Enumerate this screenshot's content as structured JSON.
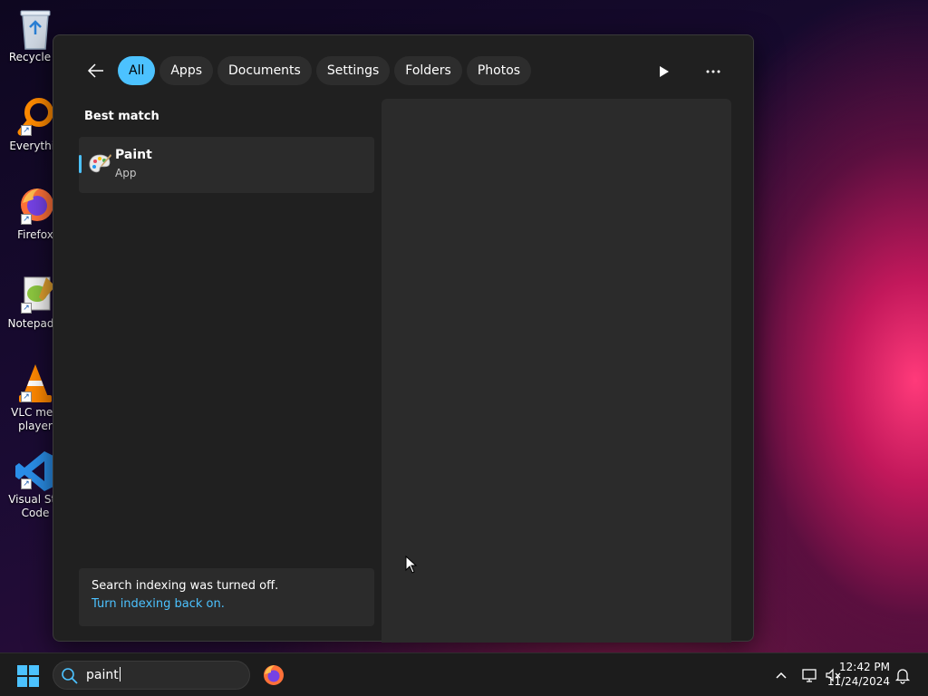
{
  "desktop": {
    "icons": [
      {
        "label": "Recycle B"
      },
      {
        "label": "Everythin"
      },
      {
        "label": "Firefox"
      },
      {
        "label": "Notepad+"
      },
      {
        "label": "VLC med player"
      },
      {
        "label": "Visual Stu Code"
      }
    ]
  },
  "search_panel": {
    "filters": [
      "All",
      "Apps",
      "Documents",
      "Settings",
      "Folders",
      "Photos"
    ],
    "active_filter": "All",
    "section_title": "Best match",
    "best_match": {
      "name": "Paint",
      "type": "App"
    },
    "notice": {
      "message": "Search indexing was turned off.",
      "link": "Turn indexing back on."
    }
  },
  "taskbar": {
    "search_value": "paint",
    "time": "12:42 PM",
    "date": "11/24/2024"
  },
  "colors": {
    "accent": "#4cc2ff",
    "panel_bg": "#202020",
    "card_bg": "#2b2b2b",
    "taskbar_bg": "#1c1c1c"
  }
}
